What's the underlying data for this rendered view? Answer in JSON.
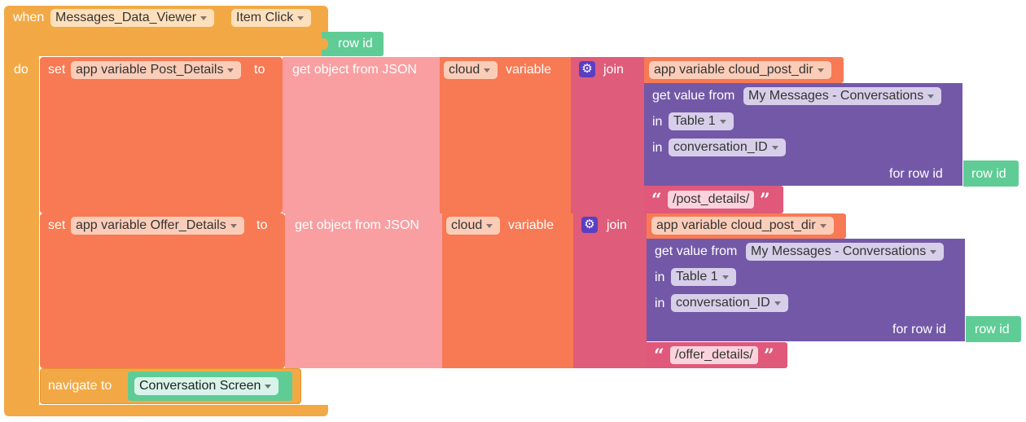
{
  "event": {
    "when_label": "when",
    "component": "Messages_Data_Viewer",
    "event_name": "Item Click",
    "param": "row id",
    "do_label": "do"
  },
  "statements": [
    {
      "set_label": "set",
      "variable": "app variable Post_Details",
      "to_label": "to",
      "get_object_label": "get object from JSON",
      "cloud_dd": "cloud",
      "variable_label": "variable",
      "join_label": "join",
      "join_first": "app variable cloud_post_dir",
      "get_value_label": "get value from",
      "data_source": "My Messages - Conversations",
      "in_label": "in",
      "table": "Table 1",
      "in_label2": "in",
      "column": "conversation_ID",
      "for_row_label": "for row id",
      "row_id": "row id",
      "string_value": "/post_details/"
    },
    {
      "set_label": "set",
      "variable": "app variable Offer_Details",
      "to_label": "to",
      "get_object_label": "get object from JSON",
      "cloud_dd": "cloud",
      "variable_label": "variable",
      "join_label": "join",
      "join_first": "app variable cloud_post_dir",
      "get_value_label": "get value from",
      "data_source": "My Messages - Conversations",
      "in_label": "in",
      "table": "Table 1",
      "in_label2": "in",
      "column": "conversation_ID",
      "for_row_label": "for row id",
      "row_id": "row id",
      "string_value": "/offer_details/"
    }
  ],
  "navigate": {
    "label": "navigate to",
    "screen": "Conversation Screen"
  },
  "icons": {
    "join_icon": "gear-icon",
    "dropdown_icon": "chevron-down-icon"
  },
  "colors": {
    "event_block": "#f2a945",
    "set_block": "#f77a54",
    "json_block": "#f99fa1",
    "cloud_block": "#f77a54",
    "join_block": "#df5c7a",
    "data_block": "#7458a8",
    "row_id_block": "#5fcc96",
    "string_block": "#e0587a"
  }
}
